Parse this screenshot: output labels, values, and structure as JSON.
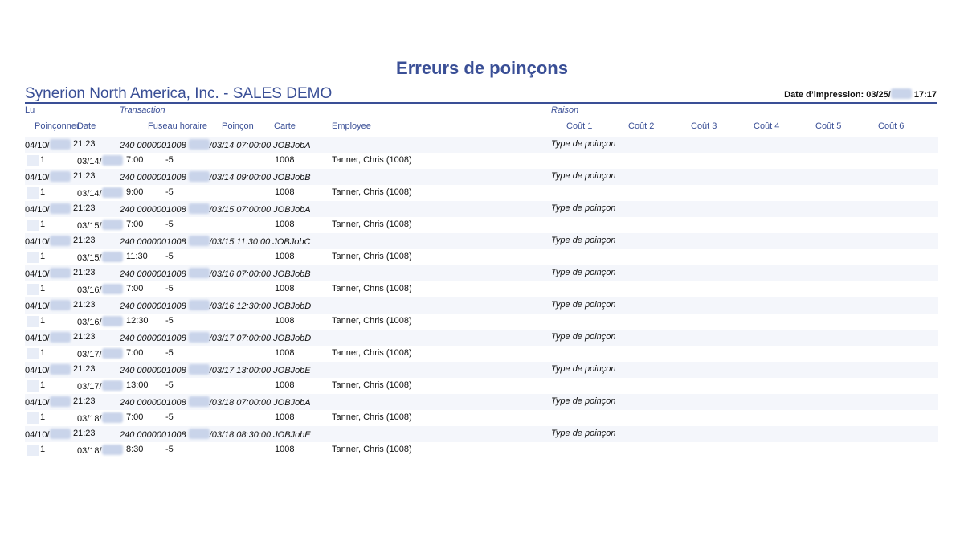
{
  "report": {
    "title": "Erreurs de poinçons",
    "company": "Synerion North America, Inc. - SALES DEMO",
    "print_date_label": "Date d’impression: 03/25/",
    "print_time": "17:17"
  },
  "columns": {
    "lu": "Lu",
    "transaction": "Transaction",
    "raison": "Raison",
    "poinconneuse": "Poinçonneuse",
    "date": "Date",
    "fuseau": "Fuseau horaire",
    "poincon": "Poinçon",
    "carte": "Carte",
    "employee": "Employee",
    "couts": [
      "Coût 1",
      "Coût 2",
      "Coût 3",
      "Coût 4",
      "Coût 5",
      "Coût 6"
    ]
  },
  "records": [
    {
      "lu_date": "04/10/",
      "lu_time": "21:23",
      "tx_prefix": "240 0000001008 ",
      "tx_suffix": "/03/14 07:00:00 JOBJobA",
      "reason": "Type de poinçon",
      "clock": "1",
      "date": "03/14/",
      "time": "7:00",
      "tz": "-5",
      "card": "1008",
      "employee": "Tanner, Chris (1008)"
    },
    {
      "lu_date": "04/10/",
      "lu_time": "21:23",
      "tx_prefix": "240 0000001008 ",
      "tx_suffix": "/03/14 09:00:00 JOBJobB",
      "reason": "Type de poinçon",
      "clock": "1",
      "date": "03/14/",
      "time": "9:00",
      "tz": "-5",
      "card": "1008",
      "employee": "Tanner, Chris (1008)"
    },
    {
      "lu_date": "04/10/",
      "lu_time": "21:23",
      "tx_prefix": "240 0000001008 ",
      "tx_suffix": "/03/15 07:00:00 JOBJobA",
      "reason": "Type de poinçon",
      "clock": "1",
      "date": "03/15/",
      "time": "7:00",
      "tz": "-5",
      "card": "1008",
      "employee": "Tanner, Chris (1008)"
    },
    {
      "lu_date": "04/10/",
      "lu_time": "21:23",
      "tx_prefix": "240 0000001008 ",
      "tx_suffix": "/03/15 11:30:00 JOBJobC",
      "reason": "Type de poinçon",
      "clock": "1",
      "date": "03/15/",
      "time": "11:30",
      "tz": "-5",
      "card": "1008",
      "employee": "Tanner, Chris (1008)"
    },
    {
      "lu_date": "04/10/",
      "lu_time": "21:23",
      "tx_prefix": "240 0000001008 ",
      "tx_suffix": "/03/16 07:00:00 JOBJobB",
      "reason": "Type de poinçon",
      "clock": "1",
      "date": "03/16/",
      "time": "7:00",
      "tz": "-5",
      "card": "1008",
      "employee": "Tanner, Chris (1008)"
    },
    {
      "lu_date": "04/10/",
      "lu_time": "21:23",
      "tx_prefix": "240 0000001008 ",
      "tx_suffix": "/03/16 12:30:00 JOBJobD",
      "reason": "Type de poinçon",
      "clock": "1",
      "date": "03/16/",
      "time": "12:30",
      "tz": "-5",
      "card": "1008",
      "employee": "Tanner, Chris (1008)"
    },
    {
      "lu_date": "04/10/",
      "lu_time": "21:23",
      "tx_prefix": "240 0000001008 ",
      "tx_suffix": "/03/17 07:00:00 JOBJobD",
      "reason": "Type de poinçon",
      "clock": "1",
      "date": "03/17/",
      "time": "7:00",
      "tz": "-5",
      "card": "1008",
      "employee": "Tanner, Chris (1008)"
    },
    {
      "lu_date": "04/10/",
      "lu_time": "21:23",
      "tx_prefix": "240 0000001008 ",
      "tx_suffix": "/03/17 13:00:00 JOBJobE",
      "reason": "Type de poinçon",
      "clock": "1",
      "date": "03/17/",
      "time": "13:00",
      "tz": "-5",
      "card": "1008",
      "employee": "Tanner, Chris (1008)"
    },
    {
      "lu_date": "04/10/",
      "lu_time": "21:23",
      "tx_prefix": "240 0000001008 ",
      "tx_suffix": "/03/18 07:00:00 JOBJobA",
      "reason": "Type de poinçon",
      "clock": "1",
      "date": "03/18/",
      "time": "7:00",
      "tz": "-5",
      "card": "1008",
      "employee": "Tanner, Chris (1008)"
    },
    {
      "lu_date": "04/10/",
      "lu_time": "21:23",
      "tx_prefix": "240 0000001008 ",
      "tx_suffix": "/03/18 08:30:00 JOBJobE",
      "reason": "Type de poinçon",
      "clock": "1",
      "date": "03/18/",
      "time": "8:30",
      "tz": "-5",
      "card": "1008",
      "employee": "Tanner, Chris (1008)"
    }
  ]
}
